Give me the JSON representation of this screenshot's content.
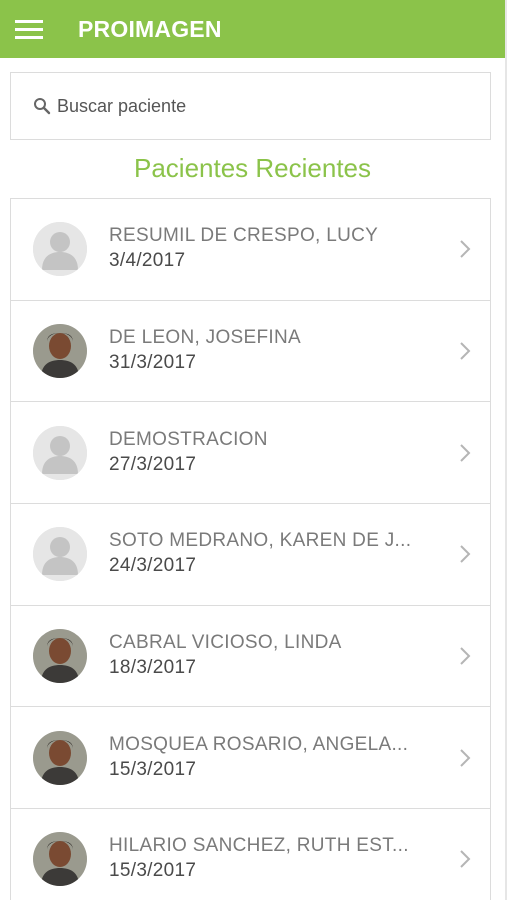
{
  "header": {
    "title": "PROIMAGEN",
    "color": "#8bc34a",
    "menu_icon": "hamburger-menu-icon"
  },
  "search": {
    "placeholder": "Buscar paciente",
    "icon": "search-icon"
  },
  "section_title": "Pacientes Recientes",
  "patients": [
    {
      "name": "RESUMIL DE CRESPO, LUCY",
      "date": "3/4/2017",
      "photo": "default"
    },
    {
      "name": "DE LEON, JOSEFINA",
      "date": "31/3/2017",
      "photo": "photo"
    },
    {
      "name": "DEMOSTRACION",
      "date": "27/3/2017",
      "photo": "default"
    },
    {
      "name": "SOTO MEDRANO, KAREN DE J...",
      "date": "24/3/2017",
      "photo": "default"
    },
    {
      "name": "CABRAL VICIOSO, LINDA",
      "date": "18/3/2017",
      "photo": "photo"
    },
    {
      "name": "MOSQUEA ROSARIO, ANGELA...",
      "date": "15/3/2017",
      "photo": "photo"
    },
    {
      "name": "HILARIO SANCHEZ, RUTH EST...",
      "date": "15/3/2017",
      "photo": "photo"
    }
  ]
}
